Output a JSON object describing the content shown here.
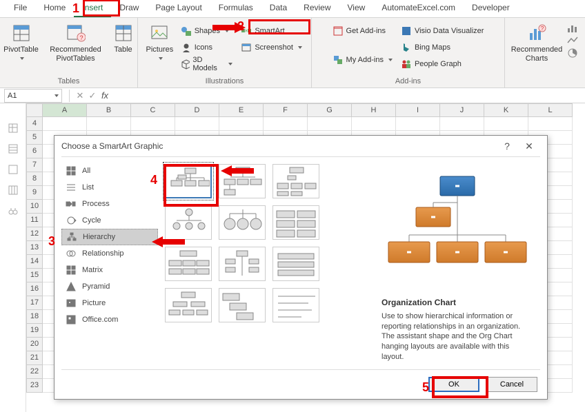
{
  "tabs": [
    "File",
    "Home",
    "Insert",
    "Draw",
    "Page Layout",
    "Formulas",
    "Data",
    "Review",
    "View",
    "AutomateExcel.com",
    "Developer"
  ],
  "steps": {
    "one": "1",
    "two": "2",
    "three": "3",
    "four": "4",
    "five": "5"
  },
  "ribbon": {
    "tables": {
      "pivot": "PivotTable",
      "recpivot": "Recommended\nPivotTables",
      "table": "Table",
      "label": "Tables"
    },
    "ill": {
      "pictures": "Pictures",
      "shapes": "Shapes",
      "icons": "Icons",
      "models": "3D Models",
      "smartart": "SmartArt",
      "screenshot": "Screenshot",
      "label": "Illustrations"
    },
    "addins": {
      "get": "Get Add-ins",
      "my": "My Add-ins",
      "visio": "Visio Data Visualizer",
      "bing": "Bing Maps",
      "people": "People Graph",
      "label": "Add-ins"
    },
    "charts": {
      "rec": "Recommended\nCharts",
      "label": ""
    }
  },
  "namebox": "A1",
  "cols": [
    "A",
    "B",
    "C",
    "D",
    "E",
    "F",
    "G",
    "H",
    "I",
    "J",
    "K",
    "L"
  ],
  "rowstart": 4,
  "rowcount": 20,
  "dialog": {
    "title": "Choose a SmartArt Graphic",
    "help": "?",
    "close": "✕",
    "cats": [
      "All",
      "List",
      "Process",
      "Cycle",
      "Hierarchy",
      "Relationship",
      "Matrix",
      "Pyramid",
      "Picture",
      "Office.com"
    ],
    "preview_title": "Organization Chart",
    "preview_desc": "Use to show hierarchical information or reporting relationships in an organization. The assistant shape and the Org Chart hanging layouts are available with this layout.",
    "ok": "OK",
    "cancel": "Cancel"
  }
}
